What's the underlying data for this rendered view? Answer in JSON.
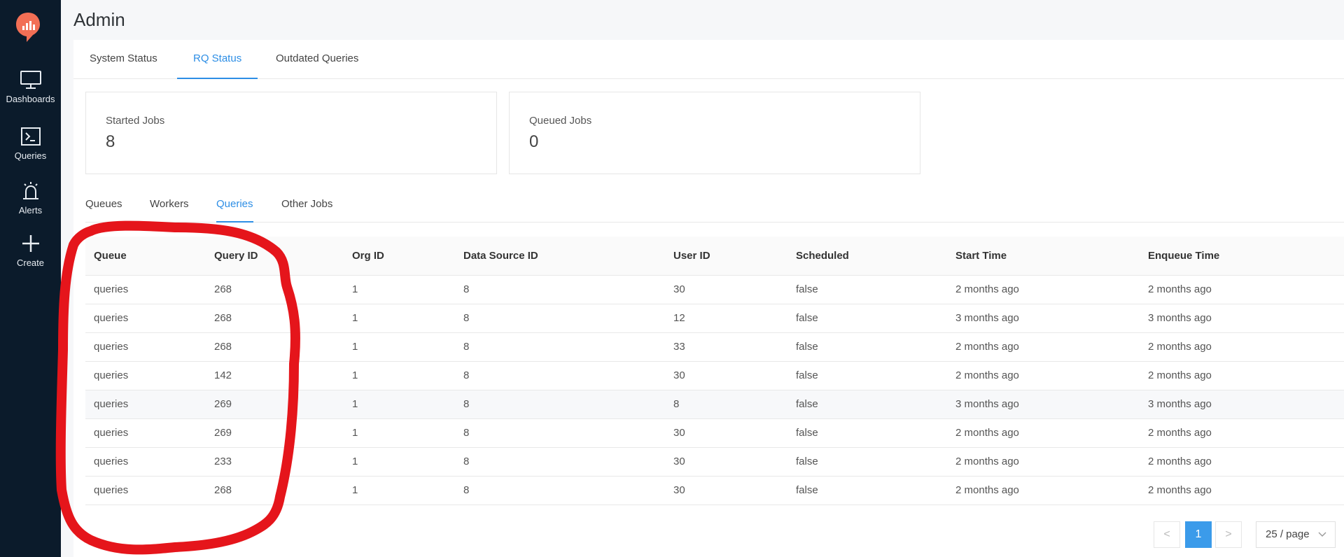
{
  "sidebar": {
    "items": [
      {
        "label": "Dashboards",
        "icon": "monitor-icon"
      },
      {
        "label": "Queries",
        "icon": "terminal-icon"
      },
      {
        "label": "Alerts",
        "icon": "alarm-icon"
      },
      {
        "label": "Create",
        "icon": "plus-icon"
      }
    ]
  },
  "page": {
    "title": "Admin"
  },
  "top_tabs": [
    "System Status",
    "RQ Status",
    "Outdated Queries"
  ],
  "active_top_tab": "RQ Status",
  "cards": [
    {
      "label": "Started Jobs",
      "value": "8"
    },
    {
      "label": "Queued Jobs",
      "value": "0"
    }
  ],
  "sub_tabs": [
    "Queues",
    "Workers",
    "Queries",
    "Other Jobs"
  ],
  "active_sub_tab": "Queries",
  "table": {
    "headers": [
      "Queue",
      "Query ID",
      "Org ID",
      "Data Source ID",
      "User ID",
      "Scheduled",
      "Start Time",
      "Enqueue Time"
    ],
    "rows": [
      [
        "queries",
        "268",
        "1",
        "8",
        "30",
        "false",
        "2 months ago",
        "2 months ago"
      ],
      [
        "queries",
        "268",
        "1",
        "8",
        "12",
        "false",
        "3 months ago",
        "3 months ago"
      ],
      [
        "queries",
        "268",
        "1",
        "8",
        "33",
        "false",
        "2 months ago",
        "2 months ago"
      ],
      [
        "queries",
        "142",
        "1",
        "8",
        "30",
        "false",
        "2 months ago",
        "2 months ago"
      ],
      [
        "queries",
        "269",
        "1",
        "8",
        "8",
        "false",
        "3 months ago",
        "3 months ago"
      ],
      [
        "queries",
        "269",
        "1",
        "8",
        "30",
        "false",
        "2 months ago",
        "2 months ago"
      ],
      [
        "queries",
        "233",
        "1",
        "8",
        "30",
        "false",
        "2 months ago",
        "2 months ago"
      ],
      [
        "queries",
        "268",
        "1",
        "8",
        "30",
        "false",
        "2 months ago",
        "2 months ago"
      ]
    ]
  },
  "pagination": {
    "prev": "<",
    "current_page": "1",
    "next": ">",
    "page_size": "25 / page"
  },
  "colors": {
    "sidebar_bg": "#0b1b2b",
    "accent": "#2d8ee5",
    "logo": "#f26f55",
    "annotation": "#e5151b"
  }
}
